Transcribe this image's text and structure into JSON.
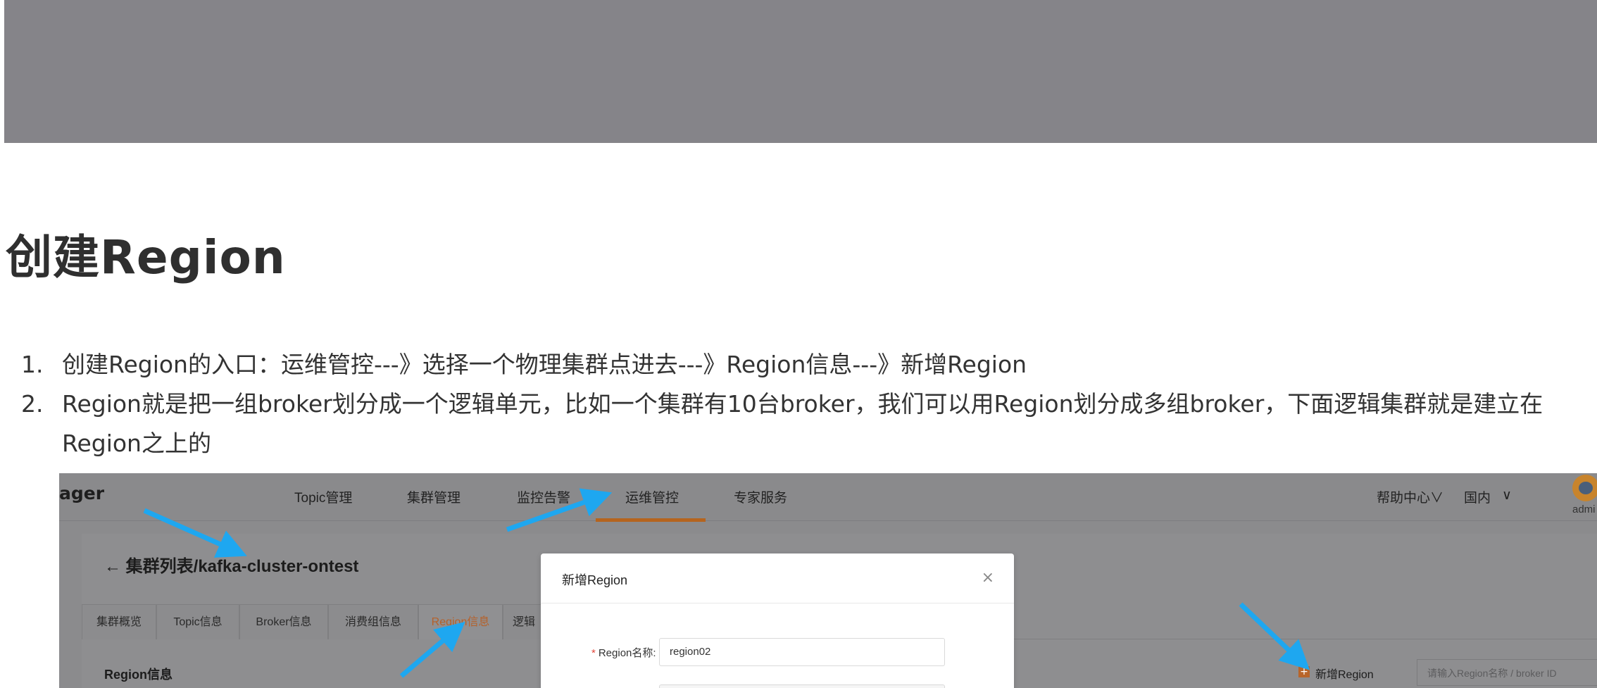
{
  "heading": "创建Region",
  "steps": [
    {
      "num": "1.",
      "text": "创建Region的入口：运维管控---》选择一个物理集群点进去---》Region信息---》新增Region"
    },
    {
      "num": "2.",
      "text": "Region就是把一组broker划分成一个逻辑单元，比如一个集群有10台broker，我们可以用Region划分成多组broker，下面逻辑集群就是建立在Region之上的"
    }
  ],
  "screenshot": {
    "brand": "ager",
    "nav": [
      "Topic管理",
      "集群管理",
      "监控告警",
      "运维管控",
      "专家服务"
    ],
    "nav_right": [
      "帮助中心∨",
      "国内",
      "∨"
    ],
    "user": "admi",
    "breadcrumb": "←  集群列表/kafka-cluster-ontest",
    "tabs": [
      "集群概览",
      "Topic信息",
      "Broker信息",
      "消费组信息",
      "Region信息",
      "逻辑"
    ],
    "section_title": "Region信息",
    "add_button": "新增Region",
    "add_icon": "+",
    "search_placeholder": "请输入Region名称 / broker ID",
    "modal": {
      "title": "新增Region",
      "close": "×",
      "field_label": "Region名称:",
      "required_mark": "*",
      "field_value": "region02"
    }
  },
  "colors": {
    "banner": "#858489",
    "accent": "#b5641e",
    "arrow": "#1ea7f0"
  }
}
